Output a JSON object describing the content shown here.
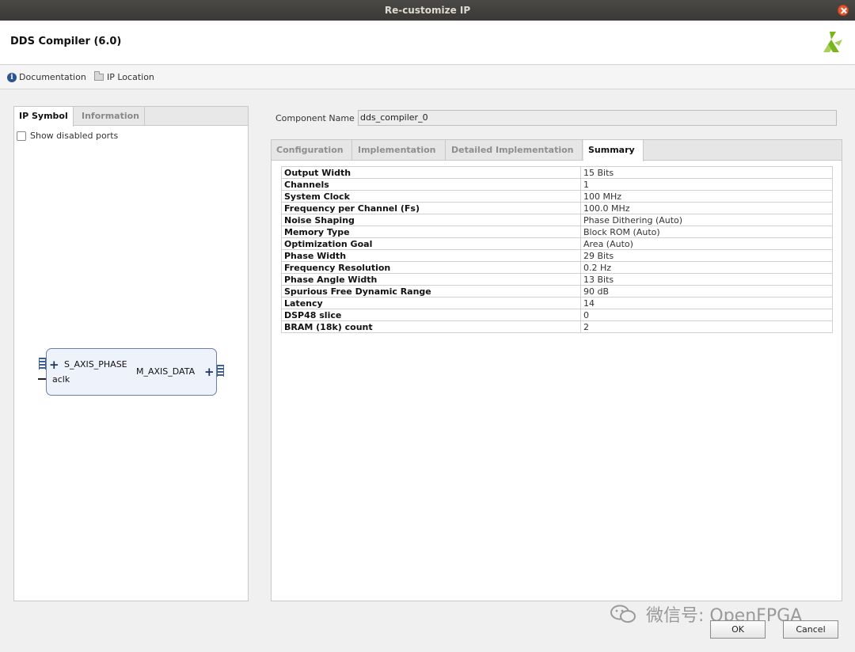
{
  "window": {
    "title": "Re-customize IP"
  },
  "header": {
    "title": "DDS Compiler (6.0)"
  },
  "links": {
    "documentation": "Documentation",
    "ip_location": "IP Location"
  },
  "left": {
    "tabs": [
      "IP Symbol",
      "Information"
    ],
    "show_disabled_ports": "Show disabled ports",
    "block": {
      "s_axis_phase": "S_AXIS_PHASE",
      "aclk": "aclk",
      "m_axis_data": "M_AXIS_DATA"
    }
  },
  "component": {
    "label": "Component Name",
    "value": "dds_compiler_0"
  },
  "tabs": [
    "Configuration",
    "Implementation",
    "Detailed Implementation",
    "Summary"
  ],
  "summary": [
    [
      "Output Width",
      "15 Bits"
    ],
    [
      "Channels",
      "1"
    ],
    [
      "System Clock",
      "100 MHz"
    ],
    [
      "Frequency per Channel (Fs)",
      "100.0 MHz"
    ],
    [
      "Noise Shaping",
      "Phase Dithering (Auto)"
    ],
    [
      "Memory Type",
      "Block ROM (Auto)"
    ],
    [
      "Optimization Goal",
      "Area (Auto)"
    ],
    [
      "Phase Width",
      "29 Bits"
    ],
    [
      "Frequency Resolution",
      "0.2 Hz"
    ],
    [
      "Phase Angle Width",
      "13 Bits"
    ],
    [
      "Spurious Free Dynamic Range",
      "90 dB"
    ],
    [
      "Latency",
      "14"
    ],
    [
      "DSP48 slice",
      "0"
    ],
    [
      "BRAM (18k) count",
      "2"
    ]
  ],
  "watermark": "微信号: OpenFPGA",
  "buttons": {
    "ok": "OK",
    "cancel": "Cancel"
  },
  "colors": {
    "titlebar": "#3a3936",
    "accent": "#2b5592",
    "block_fill": "#eef3fb",
    "logo_green": "#7ab51d"
  }
}
